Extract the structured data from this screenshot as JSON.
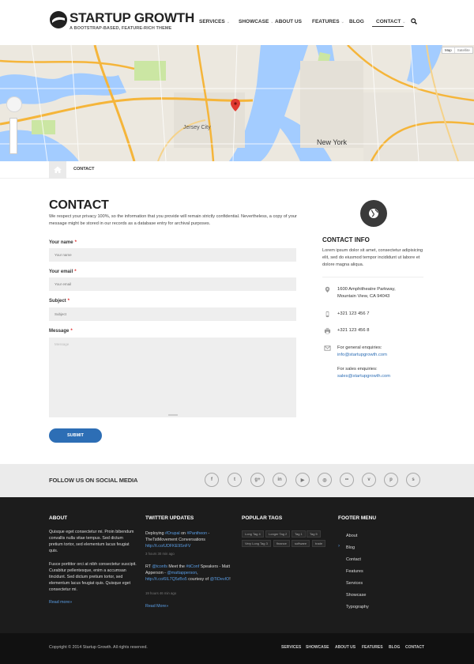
{
  "header": {
    "logo_title": "STARTUP GROWTH",
    "logo_tagline": "A BOOTSTRAP-BASED, FEATURE-RICH THEME",
    "nav": [
      {
        "label": "SERVICES",
        "dropdown": true
      },
      {
        "label": "SHOWCASE",
        "dropdown": true
      },
      {
        "label": "ABOUT US",
        "dropdown": false
      },
      {
        "label": "FEATURES",
        "dropdown": true
      },
      {
        "label": "BLOG",
        "dropdown": false
      },
      {
        "label": "CONTACT",
        "dropdown": true,
        "active": true
      }
    ],
    "search_icon": "search-icon"
  },
  "map": {
    "type_buttons": [
      "Map",
      "Satellite"
    ],
    "labels": {
      "jersey_city": "Jersey City",
      "new_york": "New York"
    }
  },
  "breadcrumb": {
    "home_icon": "home-icon",
    "current": "CONTACT"
  },
  "contact_form": {
    "title": "CONTACT",
    "intro": "We respect your privacy 100%, so the information that you provide will remain strictly confidential. Nevertheless, a copy of your message might be stored in our records as a database entry for archival purposes.",
    "fields": {
      "name": {
        "label": "Your name",
        "placeholder": "Your name"
      },
      "email": {
        "label": "Your email",
        "placeholder": "Your email"
      },
      "subject": {
        "label": "Subject",
        "placeholder": "Subject"
      },
      "message": {
        "label": "Message",
        "placeholder": "Message"
      }
    },
    "required_mark": "*",
    "submit_label": "SUBMIT"
  },
  "contact_info": {
    "title": "CONTACT INFO",
    "text": "Lorem ipsum dolor sit amet, consectetur adipisicing elit, sed do eiusmod tempor incididunt ut labore et dolore magna aliqua.",
    "address_1": "1600 Amphitheatre Parkway,",
    "address_2": "Mountain View, CA 94043",
    "phone": "+321 123 456 7",
    "fax": "+321 123 456 8",
    "general_label": "For general enquiries:",
    "general_email": "info@startupgrowth.com",
    "sales_label": "For sales enquiries:",
    "sales_email": "sales@startupgrowth.com"
  },
  "social": {
    "title": "FOLLOW US ON SOCIAL MEDIA",
    "icons": [
      "facebook-icon",
      "twitter-icon",
      "google-plus-icon",
      "linkedin-icon",
      "youtube-icon",
      "instagram-icon",
      "flickr-icon",
      "vimeo-icon",
      "pinterest-icon",
      "skype-icon"
    ]
  },
  "footer": {
    "about": {
      "title": "ABOUT",
      "p1": "Quisque eget consectetur mi. Proin bibendum convallis nulla vitae tempus. Sed dictum pretium tortor, sed elementum lacus feugiat quis.",
      "p2": "Fusce porttitor orci at nibh consectetur suscipit. Curabitur pellentesque, enim a accumsan tincidunt. Sed dictum pretium tortor, sed elementum lacus feugiat quis. Quisque eget consectetur mi.",
      "read_more": "Read more»"
    },
    "twitter": {
      "title": "TWITTER UPDATES",
      "t1_a": "Deploying ",
      "t1_b": "#Drupal",
      "t1_c": " on ",
      "t1_d": "#Pantheon",
      "t1_e": " - TheTstMovement Conversations ",
      "t1_f": "http://t.co/UDFKE9SnFV",
      "t1_meta": "3 hours 30 min ago",
      "t2_a": "RT ",
      "t2_b": "@tconfs",
      "t2_c": " Meet the ",
      "t2_d": "#tiConf",
      "t2_e": " Speakers - Matt Apperson - ",
      "t2_f": "@mattapperson",
      "t2_g": ", ",
      "t2_h": "http://t.co/6IL7Q5zBo5",
      "t2_i": " courtesy of ",
      "t2_j": "@TiDevIO",
      "t2_k": "!",
      "t2_meta": "19 hours 46 min ago",
      "read_more": "Read More»"
    },
    "tags": {
      "title": "POPULAR TAGS",
      "items": [
        "Long Tag 4",
        "Longer Tag 2",
        "Tag 1",
        "Tag 5",
        "Very Long Tag 3",
        "finance",
        "software",
        "trade"
      ]
    },
    "menu": {
      "title": "FOOTER MENU",
      "items": [
        "About",
        "Blog",
        "Contact",
        "Features",
        "Services",
        "Showcase",
        "Typography"
      ]
    }
  },
  "copyright": {
    "text": "Copyright © 2014 Startup Growth. All rights reserved.",
    "links": [
      "SERVICES",
      "SHOWCASE",
      "ABOUT US",
      "FEATURES",
      "BLOG",
      "CONTACT"
    ]
  },
  "colors": {
    "accent": "#2d6eb5",
    "footer_bg": "#1c1c1c",
    "copyright_bg": "#111111",
    "social_bg": "#ebebeb"
  }
}
